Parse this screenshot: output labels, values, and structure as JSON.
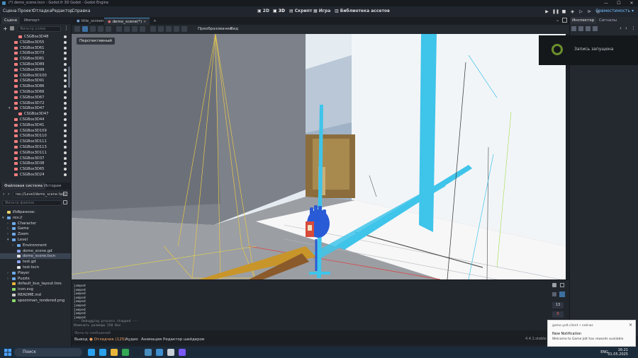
{
  "window": {
    "title": "(*) demo_scene.tscn - Godot.fr 3D Godot - Godot Engine",
    "minimize": "—",
    "maximize": "☐",
    "close": "✕"
  },
  "menubar": {
    "items": [
      "Сцена",
      "Проект",
      "Отладка",
      "Редактор",
      "Справка"
    ],
    "modes": [
      "2D",
      "3D",
      "Скрипт",
      "Игра",
      "Библиотека ассетов"
    ],
    "active_mode": "3D",
    "compat_label": "Совместимость"
  },
  "scene_dock": {
    "tabs": [
      "Сцена",
      "Импорт"
    ],
    "filter_placeholder": "Фильтр узлов",
    "nodes": [
      {
        "label": "CSGBox3D48",
        "indent": 1
      },
      {
        "label": "CSGBox3D55",
        "indent": 0
      },
      {
        "label": "CSGBox3D61",
        "indent": 0
      },
      {
        "label": "CSGBox3D73",
        "indent": 0
      },
      {
        "label": "CSGBox3D81",
        "indent": 0
      },
      {
        "label": "CSGBox3D89",
        "indent": 0
      },
      {
        "label": "CSGBox3D99",
        "indent": 0
      },
      {
        "label": "CSGBox3D100",
        "indent": 0
      },
      {
        "label": "CSGBox3D91",
        "indent": 0
      },
      {
        "label": "CSGBox3D86",
        "indent": 0
      },
      {
        "label": "CSGBox3D66",
        "indent": 0
      },
      {
        "label": "CSGBox3D67",
        "indent": 0
      },
      {
        "label": "CSGBox3D72",
        "indent": 0
      },
      {
        "label": "CSGBox3D47",
        "indent": 0,
        "expanded": true
      },
      {
        "label": "CSGBox3D47",
        "indent": 1
      },
      {
        "label": "CSGBox3D44",
        "indent": 0
      },
      {
        "label": "CSGBox3D41",
        "indent": 0
      },
      {
        "label": "CSGBox3D109",
        "indent": 0
      },
      {
        "label": "CSGBox3D110",
        "indent": 0
      },
      {
        "label": "CSGBox3D111",
        "indent": 0
      },
      {
        "label": "CSGBox3D113",
        "indent": 0
      },
      {
        "label": "CSGBox3D111",
        "indent": 0
      },
      {
        "label": "CSGBox3D37",
        "indent": 0
      },
      {
        "label": "CSGBox3D38",
        "indent": 0
      },
      {
        "label": "CSGBox3D65",
        "indent": 0
      },
      {
        "label": "CSGBox3D24",
        "indent": 0
      }
    ]
  },
  "filesystem": {
    "tabs": [
      "Файловая система",
      "История"
    ],
    "path": "res://Level/demo_scene.tscn",
    "filter_placeholder": "Фильтр файлов",
    "rows": [
      {
        "label": "Избранное:",
        "type": "fav",
        "indent": 0
      },
      {
        "label": "res://",
        "type": "folder",
        "indent": 0,
        "expanded": true
      },
      {
        "label": "Character",
        "type": "folder",
        "indent": 1
      },
      {
        "label": "Game",
        "type": "folder",
        "indent": 1
      },
      {
        "label": "Zoom",
        "type": "folder",
        "indent": 1
      },
      {
        "label": "Level",
        "type": "folder",
        "indent": 1,
        "expanded": true
      },
      {
        "label": "Environment",
        "type": "folder",
        "indent": 2
      },
      {
        "label": "demo_scene.gd",
        "type": "script",
        "indent": 2
      },
      {
        "label": "demo_scene.tscn",
        "type": "scene",
        "indent": 2,
        "selected": true
      },
      {
        "label": "test.gd",
        "type": "script",
        "indent": 2
      },
      {
        "label": "test.tscn",
        "type": "scene",
        "indent": 2
      },
      {
        "label": "Player",
        "type": "folder",
        "indent": 1
      },
      {
        "label": "Puzzle",
        "type": "folder",
        "indent": 1
      },
      {
        "label": "default_bus_layout.tres",
        "type": "resource",
        "indent": 1
      },
      {
        "label": "icon.svg",
        "type": "image",
        "indent": 1
      },
      {
        "label": "README.md",
        "type": "text",
        "indent": 1
      },
      {
        "label": "spoonman_rendered.png",
        "type": "image",
        "indent": 1
      }
    ]
  },
  "scene_tabs": {
    "tabs": [
      "title_screen",
      "demo_scene(*)"
    ],
    "active": 1,
    "add_label": "+"
  },
  "toolbar3d": {
    "transform_label": "Преобразование",
    "view_label": "Вид"
  },
  "viewport": {
    "perspective_label": "Перспективный"
  },
  "output": {
    "lines": [
      "jumped",
      "jumped",
      "jumped",
      "jumped",
      "jumped",
      "jumped",
      "jumped",
      "jumped",
      "jumped"
    ],
    "stop_line": "--- Debugging process stopped ---",
    "time_line": "Изменить размеры 250 Box",
    "filter_placeholder": "Фильтр сообщений",
    "count_a": "13",
    "count_b": "0"
  },
  "bottom_bar": {
    "items": [
      "Вывод",
      "Отладчик (125)",
      "Аудио",
      "Анимация",
      "Редактор шейдеров"
    ],
    "version": "4.4.1.stable"
  },
  "right_dock": {
    "tabs": [
      "Инспектор",
      "Сигналы"
    ]
  },
  "record_popup": {
    "label": "Запись запущена"
  },
  "notification": {
    "app": "game.yolt.client • сейчас",
    "title": "New Notification",
    "body": "Welcome to Game Jolt has rewards available"
  },
  "taskbar": {
    "search_label": "Поиск",
    "lang": "ENG",
    "time": "16:21",
    "date": "01.05.2025"
  },
  "colors": {
    "accent": "#478cbf",
    "node_icon": "#fc7f7f",
    "folder": "#6ea9e8",
    "cyan_beam": "#3fc4ea"
  }
}
